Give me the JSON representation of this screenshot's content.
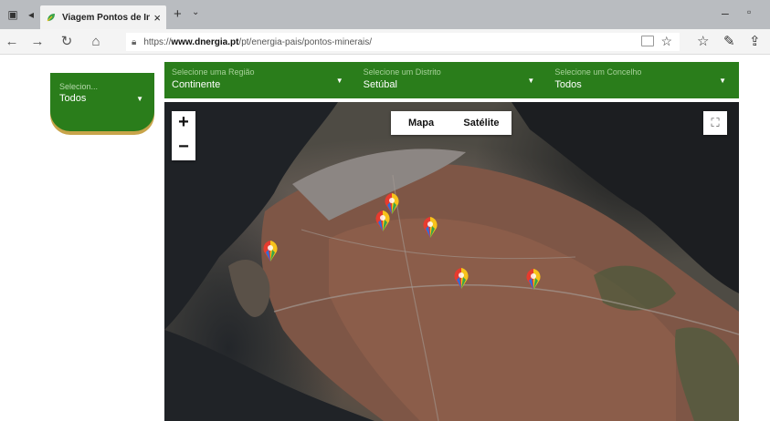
{
  "browser": {
    "tab": {
      "title": "Viagem Pontos de Inter",
      "close_icon": "×"
    },
    "new_tab_icon": "+",
    "tab_list_icon": "⌄",
    "minimize_icon": "–",
    "close_window_icon": "▫",
    "nav": {
      "back_icon": "←",
      "forward_icon": "→",
      "refresh_icon": "↻",
      "home_icon": "⌂"
    },
    "address": {
      "prefix": "https://",
      "domain": "www.dnergia.pt",
      "path": "/pt/energia-pais/pontos-minerais/"
    },
    "icons": {
      "favorites_star": "☆",
      "favorites_hub": "☆",
      "pen": "✎",
      "share": "⇪"
    }
  },
  "left_panel": {
    "label": "Selecion...",
    "value": "Todos",
    "caret": "▼"
  },
  "filters": [
    {
      "label": "Selecione uma Região",
      "value": "Continente",
      "caret": "▼"
    },
    {
      "label": "Selecione um Distrito",
      "value": "Setúbal",
      "caret": "▼"
    },
    {
      "label": "Selecione um Concelho",
      "value": "Todos",
      "caret": "▼"
    }
  ],
  "map": {
    "zoom_in": "+",
    "zoom_out": "−",
    "map_type": {
      "map_label": "Mapa",
      "satellite_label": "Satélite"
    },
    "fullscreen_icon": "⛶",
    "pin_colors": [
      "#e63b2e",
      "#f7c21a",
      "#2f6fd8",
      "#3aa34a"
    ],
    "water_color": "#1f2226",
    "urban_color": "#8b5d4a",
    "brand_green": "#2a7d1b"
  }
}
